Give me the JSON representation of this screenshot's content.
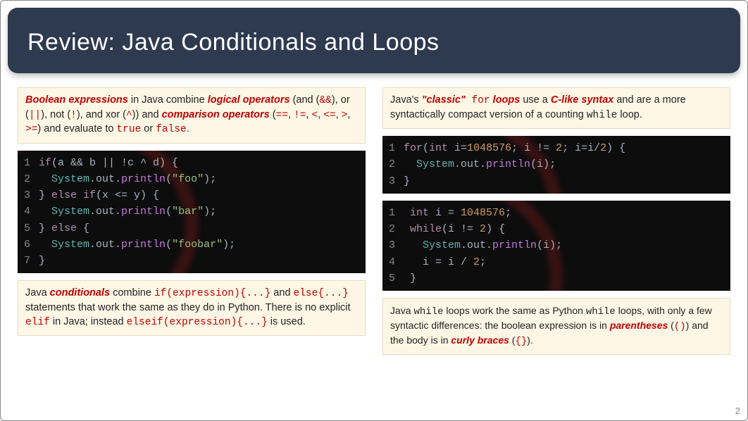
{
  "title": "Review: Java Conditionals and Loops",
  "pageNumber": "2",
  "left": {
    "box1": {
      "t0": "Boolean expressions",
      "t1": " in Java combine ",
      "t2": "logical operators",
      "t3": " (and (",
      "t4": "&&",
      "t5": "), or (",
      "t6": "||",
      "t7": "), not (",
      "t8": "!",
      "t9": "), and xor (",
      "t10": "^",
      "t11": ")) and ",
      "t12": "comparison operators",
      "t13": " (",
      "t14": "==",
      "t15": ", ",
      "t16": "!=",
      "t17": ", ",
      "t18": "<",
      "t19": ", ",
      "t20": "<=",
      "t21": ", ",
      "t22": ">",
      "t23": ", ",
      "t24": ">=",
      "t25": ") and evaluate to ",
      "t26": "true",
      "t27": " or ",
      "t28": "false",
      "t29": "."
    },
    "code1": {
      "l1a": "if",
      "l1b": "(a && b || !c ^ d) {",
      "l2a": "System",
      "l2b": ".out.",
      "l2c": "println",
      "l2d": "(",
      "l2e": "\"foo\"",
      "l2f": ");",
      "l3a": "} ",
      "l3b": "else if",
      "l3c": "(x <= y) {",
      "l4a": "System",
      "l4b": ".out.",
      "l4c": "println",
      "l4d": "(",
      "l4e": "\"bar\"",
      "l4f": ");",
      "l5a": "} ",
      "l5b": "else",
      "l5c": " {",
      "l6a": "System",
      "l6b": ".out.",
      "l6c": "println",
      "l6d": "(",
      "l6e": "\"foobar\"",
      "l6f": ");",
      "l7": "}"
    },
    "box2": {
      "t0": "Java ",
      "t1": "conditionals",
      "t2": " combine ",
      "t3": "if(expression){...}",
      "t4": " and ",
      "t5": "else{...}",
      "t6": " statements that work the same as they do in Python. There is no explicit ",
      "t7": "elif",
      "t8": " in Java; instead ",
      "t9": "elseif(expression){...}",
      "t10": " is used."
    }
  },
  "right": {
    "box1": {
      "t0": "Java's ",
      "t1": "\"classic\"",
      "t2": " for",
      "t3": " loops",
      "t4": " use a ",
      "t5": "C-like syntax",
      "t6": " and are a more syntactically compact version of a counting ",
      "t7": "while",
      "t8": " loop."
    },
    "code1": {
      "l1a": "for",
      "l1b": "(",
      "l1c": "int",
      "l1d": " i=",
      "l1e": "1048576",
      "l1f": "; i != ",
      "l1g": "2",
      "l1h": "; i=i/",
      "l1i": "2",
      "l1j": ") {",
      "l2a": "System",
      "l2b": ".out.",
      "l2c": "println",
      "l2d": "(i);",
      "l3": "}"
    },
    "code2": {
      "l1a": "int",
      "l1b": " i = ",
      "l1c": "1048576",
      "l1d": ";",
      "l2a": "while",
      "l2b": "(i != ",
      "l2c": "2",
      "l2d": ") {",
      "l3a": "System",
      "l3b": ".out.",
      "l3c": "println",
      "l3d": "(i);",
      "l4a": "i = i / ",
      "l4b": "2",
      "l4c": ";",
      "l5": "}"
    },
    "box2": {
      "t0": "Java ",
      "t1": "while",
      "t2": " loops work the same as Python ",
      "t3": "while",
      "t4": " loops, with only a few syntactic differences: the boolean expression is in ",
      "t5": "parentheses",
      "t6": " (",
      "t7": "()",
      "t8": ") and the body is in ",
      "t9": "curly braces",
      "t10": " (",
      "t11": "{}",
      "t12": ")."
    }
  }
}
